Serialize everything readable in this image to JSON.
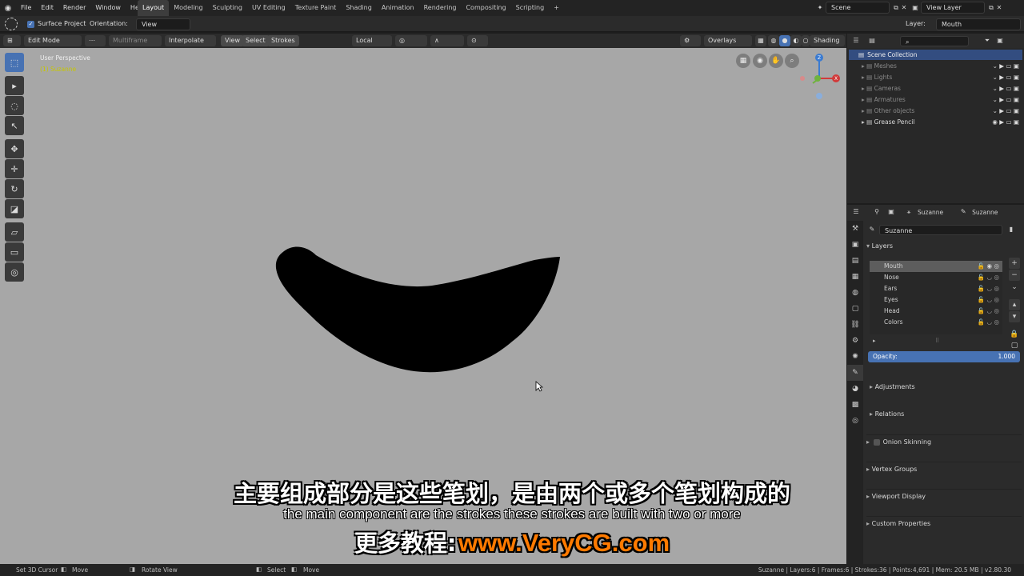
{
  "topbar": {
    "menus": [
      "File",
      "Edit",
      "Render",
      "Window",
      "Help"
    ],
    "workspaces": [
      "Layout",
      "Modeling",
      "Sculpting",
      "UV Editing",
      "Texture Paint",
      "Shading",
      "Animation",
      "Rendering",
      "Compositing",
      "Scripting"
    ],
    "active_workspace": "Layout",
    "add_tab": "+",
    "scene": "Scene",
    "view_layer": "View Layer"
  },
  "toolhdr": {
    "surface_project": "Surface Project",
    "orientation_label": "Orientation:",
    "orientation_value": "View",
    "layer_label": "Layer:",
    "layer_value": "Mouth"
  },
  "vphdr": {
    "mode": "Edit Mode",
    "multiframe": "Multiframe",
    "interpolate": "Interpolate",
    "view": "View",
    "select": "Select",
    "strokes": "Strokes",
    "local": "Local",
    "overlays": "Overlays",
    "shading": "Shading"
  },
  "viewport": {
    "perspective": "User Perspective",
    "object": "(1) Suzanne",
    "accent": "#c7c700"
  },
  "outliner": {
    "title": "Scene Collection",
    "items": [
      {
        "label": "Meshes",
        "dim": true
      },
      {
        "label": "Lights",
        "dim": true
      },
      {
        "label": "Cameras",
        "dim": true
      },
      {
        "label": "Armatures",
        "dim": true
      },
      {
        "label": "Other objects",
        "dim": true
      },
      {
        "label": "Grease Pencil",
        "dim": false
      }
    ]
  },
  "props": {
    "breadcrumb_obj": "Suzanne",
    "breadcrumb_data": "Suzanne",
    "data_name": "Suzanne",
    "layers_panel": "Layers",
    "layers": [
      "Mouth",
      "Nose",
      "Ears",
      "Eyes",
      "Head",
      "Colors"
    ],
    "selected_layer": "Mouth",
    "opacity_label": "Opacity:",
    "opacity_value": "1.000",
    "opacity": 1.0,
    "adjustments": "Adjustments",
    "relations": "Relations",
    "onion": "Onion Skinning",
    "vertex_groups": "Vertex Groups",
    "viewport_display": "Viewport Display",
    "custom_props": "Custom Properties"
  },
  "status": {
    "set_cursor": "Set 3D Cursor",
    "move1": "Move",
    "rotate": "Rotate View",
    "select": "Select",
    "move2": "Move",
    "info": "Suzanne | Layers:6 | Frames:6 | Strokes:36 | Points:4,691 | Mem: 20.5 MB | v2.80.30"
  },
  "subtitles": {
    "cn": "主要组成部分是这些笔划，是由两个或多个笔划构成的",
    "en": "the main component are the strokes these strokes are built with two or more",
    "promo_cn": "更多教程:",
    "promo_url": "www.VeryCG.com",
    "promo_color": "#ff7a00"
  },
  "colors": {
    "accent_blue": "#4772b3",
    "viewport_bg": "#a7a7a7"
  }
}
